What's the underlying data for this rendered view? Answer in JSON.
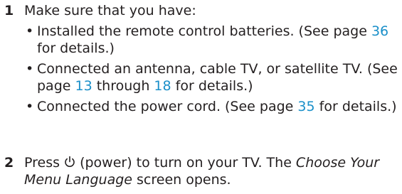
{
  "steps": [
    {
      "number": "1",
      "intro": "Make sure that you have:",
      "bullets": [
        {
          "before": "Installed the remote control batteries. (See page ",
          "link": "36",
          "after": " for details.)"
        },
        {
          "before": "Connected an antenna, cable TV, or satellite TV. (See page ",
          "link": "13",
          "middle": " through ",
          "link2": "18",
          "after": " for details.)"
        },
        {
          "before": "Connected the power cord. (See page ",
          "link": "35",
          "after": " for details.)"
        }
      ]
    },
    {
      "number": "2",
      "press": "Press ",
      "power_label": " (power) to turn on your TV. The ",
      "screen_name": "Choose Your Menu Language",
      "after": " screen opens."
    }
  ],
  "colors": {
    "text": "#231f20",
    "link": "#1a8fc9"
  },
  "icons": {
    "power": "power-icon",
    "bullet": "bullet-dot"
  }
}
